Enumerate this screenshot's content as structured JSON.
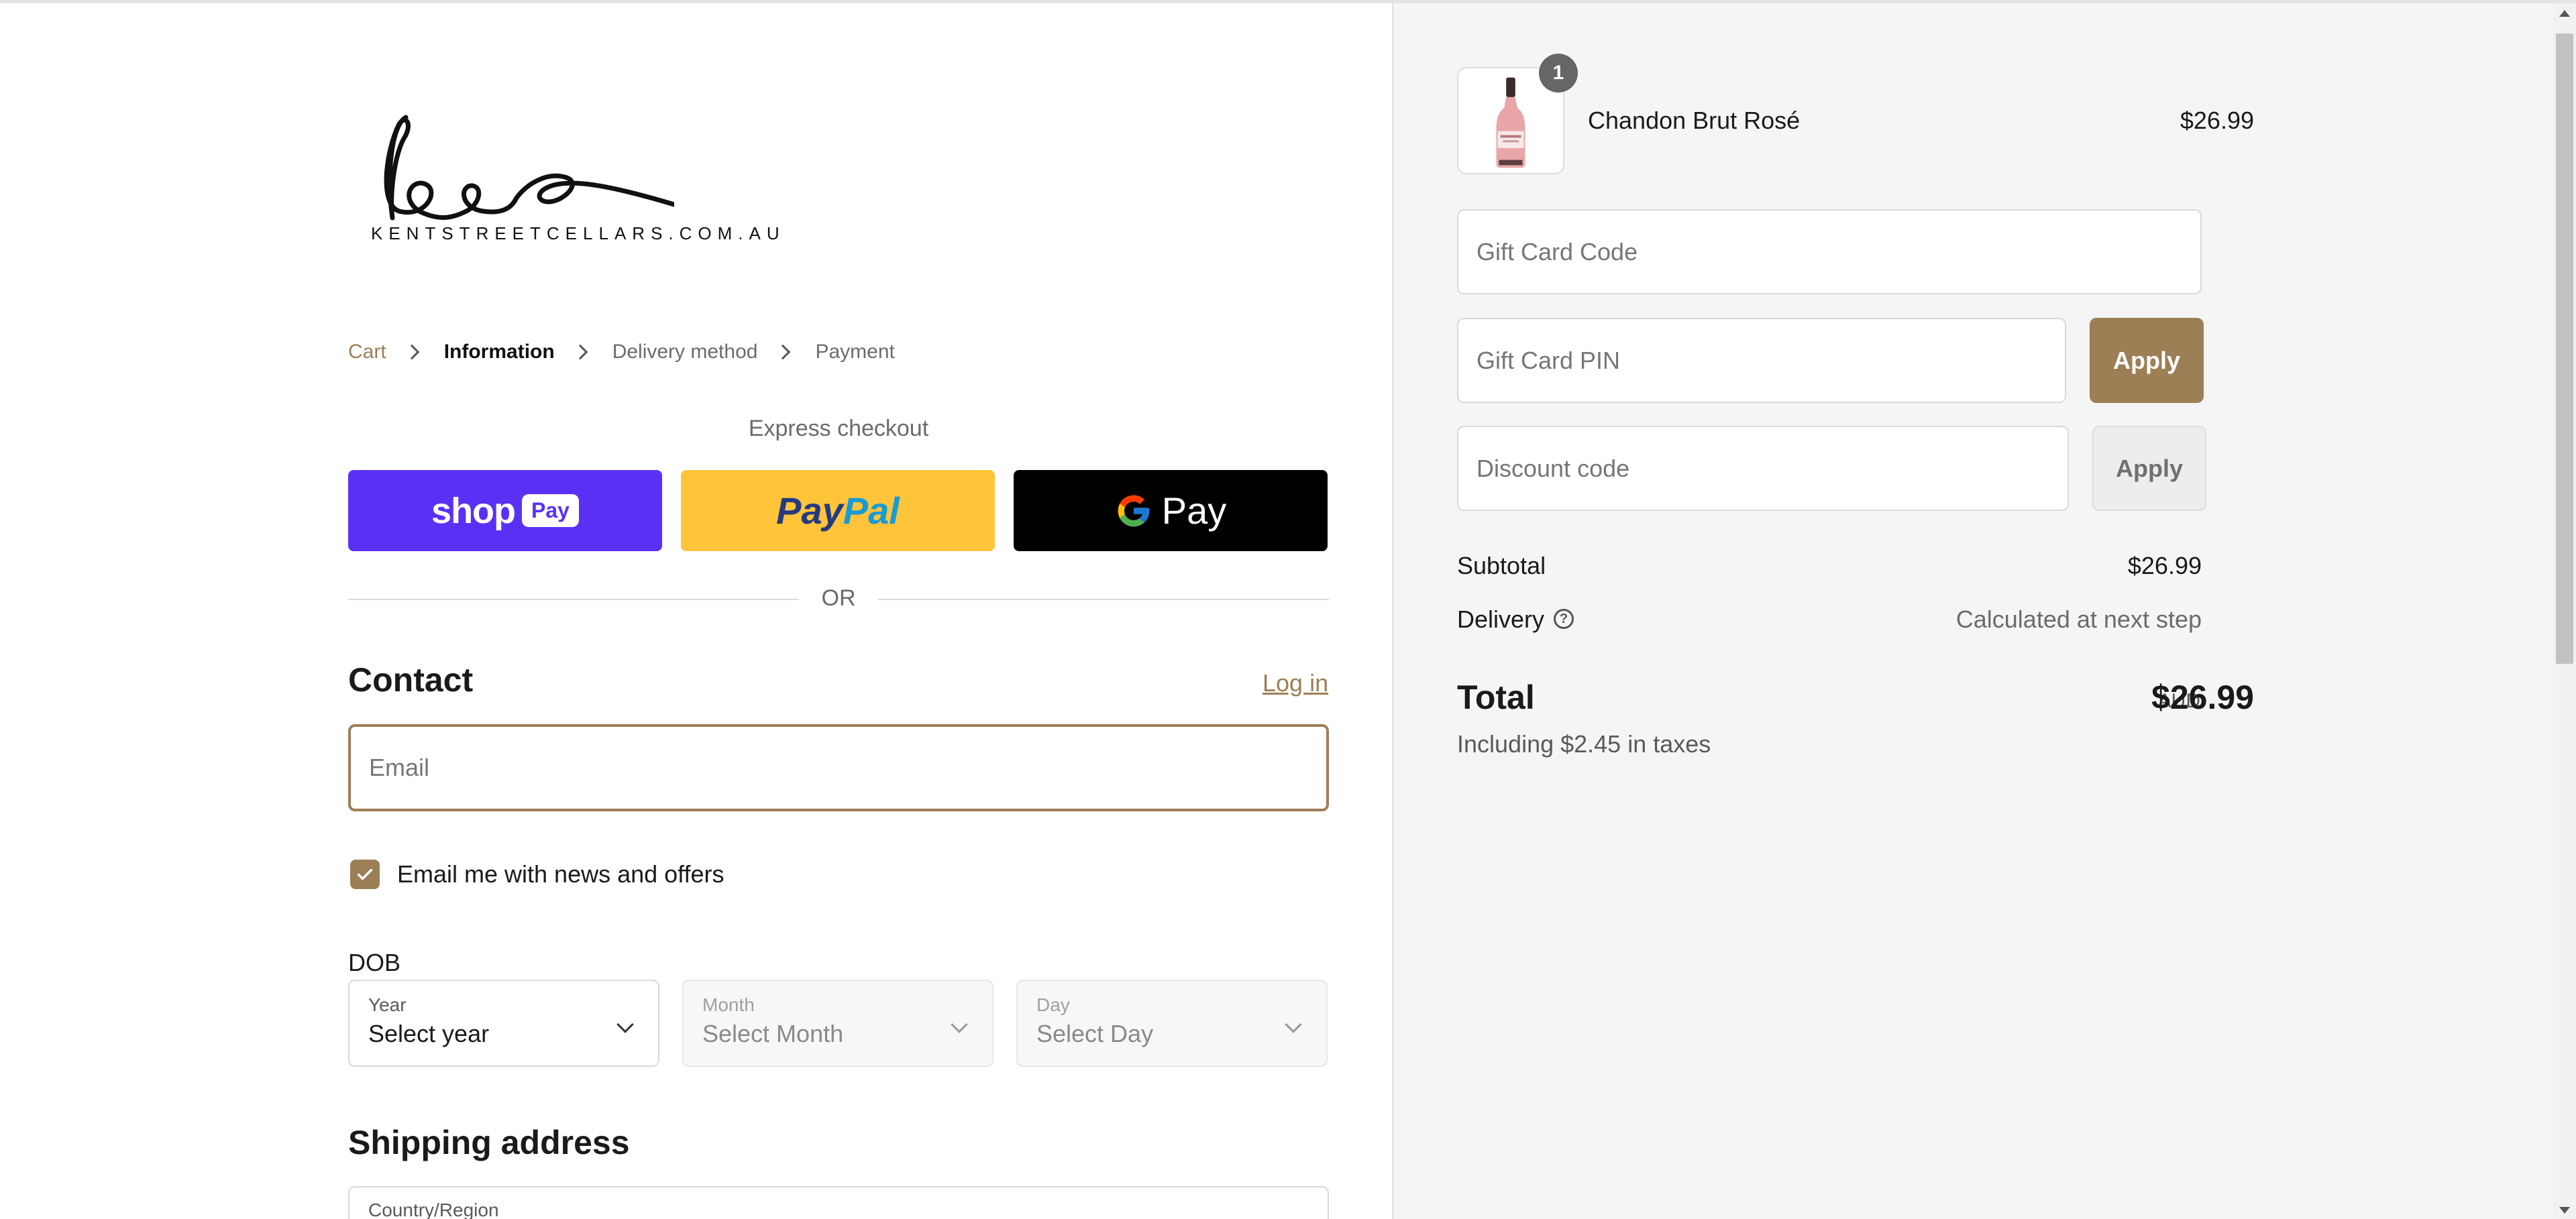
{
  "logo": {
    "text": "KENTSTREETCELLARS.COM.AU"
  },
  "breadcrumb": {
    "cart": "Cart",
    "information": "Information",
    "delivery_method": "Delivery method",
    "payment": "Payment"
  },
  "express": {
    "title": "Express checkout",
    "shop_label": "shop",
    "shop_pay_label": "Pay",
    "paypal_pay": "Pay",
    "paypal_pal": "Pal",
    "gpay_label": "Pay",
    "or_label": "OR"
  },
  "contact": {
    "title": "Contact",
    "login_label": "Log in",
    "email_placeholder": "Email",
    "newsletter_label": "Email me with news and offers",
    "newsletter_checked": true
  },
  "dob": {
    "label": "DOB",
    "year_label": "Year",
    "year_value": "Select year",
    "month_label": "Month",
    "month_value": "Select Month",
    "day_label": "Day",
    "day_value": "Select Day"
  },
  "shipping": {
    "title": "Shipping address",
    "country_label": "Country/Region"
  },
  "cart": {
    "quantity": "1",
    "product_name": "Chandon Brut Rosé",
    "product_price": "$26.99"
  },
  "gift_card": {
    "code_placeholder": "Gift Card Code",
    "pin_placeholder": "Gift Card PIN",
    "apply_label": "Apply"
  },
  "discount": {
    "placeholder": "Discount code",
    "apply_label": "Apply"
  },
  "summary": {
    "subtotal_label": "Subtotal",
    "subtotal_value": "$26.99",
    "delivery_label": "Delivery",
    "delivery_value": "Calculated at next step",
    "total_label": "Total",
    "currency": "AUD",
    "total_value": "$26.99",
    "taxes_note": "Including $2.45 in taxes"
  },
  "colors": {
    "accent": "#9c7f55",
    "shop_pay": "#5a31f4",
    "paypal": "#ffc439",
    "gpay": "#000000"
  },
  "icons": [
    "chevron-right-icon",
    "check-icon",
    "chevron-down-icon",
    "help-circle-icon",
    "google-g-icon",
    "product-bottle-icon"
  ]
}
